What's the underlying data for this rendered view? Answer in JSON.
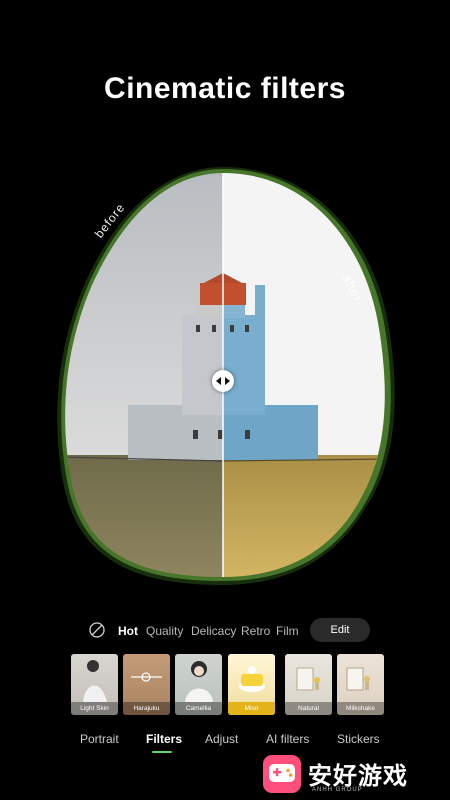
{
  "header": {
    "title": "Cinematic filters"
  },
  "preview": {
    "before_label": "before",
    "after_label": "after",
    "handle_icon": "compare-arrows-icon"
  },
  "categories": {
    "none_icon": "no-filter-icon",
    "items": [
      {
        "label": "Hot",
        "active": true
      },
      {
        "label": "Quality",
        "active": false
      },
      {
        "label": "Delicacy",
        "active": false
      },
      {
        "label": "Retro",
        "active": false
      },
      {
        "label": "Film",
        "active": false
      }
    ],
    "edit_label": "Edit"
  },
  "filters": [
    {
      "label": "Light Skin",
      "selected": false
    },
    {
      "label": "Harajuku",
      "selected": false
    },
    {
      "label": "Camellia",
      "selected": false
    },
    {
      "label": "Miso",
      "selected": true
    },
    {
      "label": "Natural",
      "selected": false
    },
    {
      "label": "Milkshake",
      "selected": false
    }
  ],
  "tabs": [
    {
      "label": "Portrait",
      "active": false
    },
    {
      "label": "Filters",
      "active": true
    },
    {
      "label": "Adjust",
      "active": false
    },
    {
      "label": "AI filters",
      "active": false
    },
    {
      "label": "Stickers",
      "active": false
    }
  ],
  "watermark": {
    "text": "安好游戏",
    "sub": "ANHH GROUP",
    "icon": "game-controller-icon"
  },
  "colors": {
    "accent": "#62d860",
    "selected_badge": "#e3b41a"
  }
}
